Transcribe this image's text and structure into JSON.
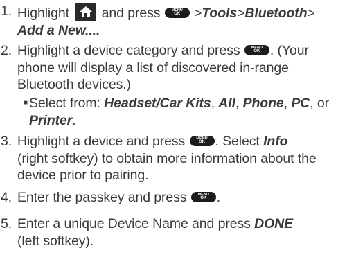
{
  "steps": [
    {
      "number": "1.",
      "t1": "Highlight",
      "t2": "and press",
      "t3": ">",
      "nav1": "Tools",
      "nav_sep": ">",
      "nav2": "Bluetooth",
      "nav3": "Add a New...."
    },
    {
      "number": "2.",
      "t1": "Highlight a device category and press",
      "t2": ". (Your",
      "line2": "phone will display a list of discovered in-range",
      "line3": "Bluetooth devices.)"
    },
    {
      "number": "3.",
      "t1": "Highlight a device and press",
      "t2": ". Select",
      "info": "Info",
      "line2": "(right softkey) to obtain more information about the",
      "line3": "device prior to pairing."
    },
    {
      "number": "4.",
      "t1": "Enter the passkey and press",
      "t2": "."
    },
    {
      "number": "5.",
      "t1": "Enter a unique Device Name and press",
      "done": "DONE",
      "line2": "(left softkey)."
    }
  ],
  "sub_bullet": {
    "symbol": "■",
    "intro": "Select from:",
    "o1": "Headset/Car Kits",
    "sep1": ",",
    "o2": "All",
    "sep2": ",",
    "o3": "Phone",
    "sep3": ",",
    "o4": "PC",
    "sep4": ", or",
    "o5": "Printer",
    "end": "."
  },
  "keys": {
    "menu_line1": "MENU",
    "menu_line2": "OK"
  },
  "icons": {
    "home": "home-icon",
    "menu_ok": "menu-ok-key-icon"
  },
  "colors": {
    "text": "#3a3a3a",
    "key_fill": "#1c1c1c",
    "home_fill": "#2a2a2a"
  }
}
